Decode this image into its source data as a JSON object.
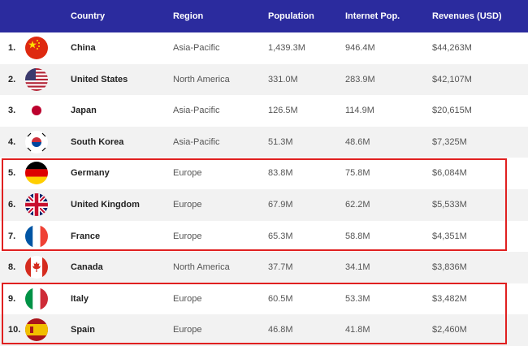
{
  "chart_data": {
    "type": "table",
    "columns": [
      "",
      "Country",
      "Region",
      "Population",
      "Internet Pop.",
      "Revenues (USD)"
    ],
    "rows": [
      {
        "rank": "1.",
        "country": "China",
        "region": "Asia-Pacific",
        "population": "1,439.3M",
        "internet": "946.4M",
        "revenue": "$44,263M",
        "flag": "china-flag-icon",
        "highlighted": false
      },
      {
        "rank": "2.",
        "country": "United States",
        "region": "North America",
        "population": "331.0M",
        "internet": "283.9M",
        "revenue": "$42,107M",
        "flag": "usa-flag-icon",
        "highlighted": false
      },
      {
        "rank": "3.",
        "country": "Japan",
        "region": "Asia-Pacific",
        "population": "126.5M",
        "internet": "114.9M",
        "revenue": "$20,615M",
        "flag": "japan-flag-icon",
        "highlighted": false
      },
      {
        "rank": "4.",
        "country": "South Korea",
        "region": "Asia-Pacific",
        "population": "51.3M",
        "internet": "48.6M",
        "revenue": "$7,325M",
        "flag": "south-korea-flag-icon",
        "highlighted": false
      },
      {
        "rank": "5.",
        "country": "Germany",
        "region": "Europe",
        "population": "83.8M",
        "internet": "75.8M",
        "revenue": "$6,084M",
        "flag": "germany-flag-icon",
        "highlighted": true
      },
      {
        "rank": "6.",
        "country": "United Kingdom",
        "region": "Europe",
        "population": "67.9M",
        "internet": "62.2M",
        "revenue": "$5,533M",
        "flag": "uk-flag-icon",
        "highlighted": true
      },
      {
        "rank": "7.",
        "country": "France",
        "region": "Europe",
        "population": "65.3M",
        "internet": "58.8M",
        "revenue": "$4,351M",
        "flag": "france-flag-icon",
        "highlighted": true
      },
      {
        "rank": "8.",
        "country": "Canada",
        "region": "North America",
        "population": "37.7M",
        "internet": "34.1M",
        "revenue": "$3,836M",
        "flag": "canada-flag-icon",
        "highlighted": false
      },
      {
        "rank": "9.",
        "country": "Italy",
        "region": "Europe",
        "population": "60.5M",
        "internet": "53.3M",
        "revenue": "$3,482M",
        "flag": "italy-flag-icon",
        "highlighted": true
      },
      {
        "rank": "10.",
        "country": "Spain",
        "region": "Europe",
        "population": "46.8M",
        "internet": "41.8M",
        "revenue": "$2,460M",
        "flag": "spain-flag-icon",
        "highlighted": true
      }
    ]
  },
  "colors": {
    "header_bg": "#2b2b9e",
    "header_text": "#ffffff",
    "highlight_border": "#e02020",
    "stripe": "#f2f2f2"
  }
}
